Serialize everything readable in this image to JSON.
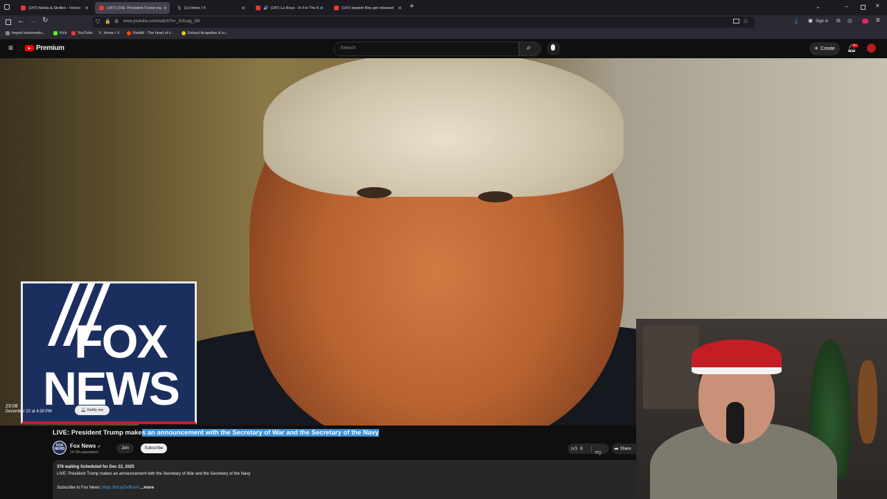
{
  "browser": {
    "tabs": [
      {
        "label": "(147) Noisia & Skrillex - Horizo"
      },
      {
        "label": "(147) LIVE: President Trump ma"
      },
      {
        "label": "(1) Home / X"
      },
      {
        "label": "(147) La Roux - In For The K"
      },
      {
        "label": "(147) epstein files get released"
      }
    ],
    "url": "www.youtube.com/watch?v=_2Utoag_2t8",
    "bookmarks": [
      "Import bookmarks...",
      "Kick",
      "YouTube",
      "Home / X",
      "Reddit - The heart of t...",
      "Extract Acapellas & In..."
    ],
    "sign_in": "Sign in",
    "colors": {
      "tabbar": "#1c1b22",
      "navbar": "#2b2a33"
    }
  },
  "youtube": {
    "logo_text": "Premium",
    "search_placeholder": "Search",
    "create_label": "Create",
    "notif_badge": "9+"
  },
  "player": {
    "logo_line1": "FOX",
    "logo_line2": "NEWS",
    "countdown": "23:08",
    "scheduled": "December 22 at 4:30 PM",
    "notify_label": "Notify me"
  },
  "video": {
    "title_plain": "LIVE: President Trump make",
    "title_selected": "s an announcement with the Secretary of War and the Secretary of the Navy",
    "channel": "Fox News",
    "channel_logo": "FOX NEWS",
    "subscribers": "14.7M subscribers",
    "join_label": "Join",
    "subscribe_label": "Subscribe",
    "likes": "6",
    "share_label": "Share",
    "description": {
      "meta": "376 waiting  Scheduled for Dec 22, 2025",
      "line1": "LIVE: President Trump makes an announcement with the Secretary of War and the Secretary of the Navy",
      "line2_prefix": "Subscribe to Fox News: ",
      "line2_link": "https://bit.ly/2vBUvA",
      "more": " ...more"
    }
  }
}
